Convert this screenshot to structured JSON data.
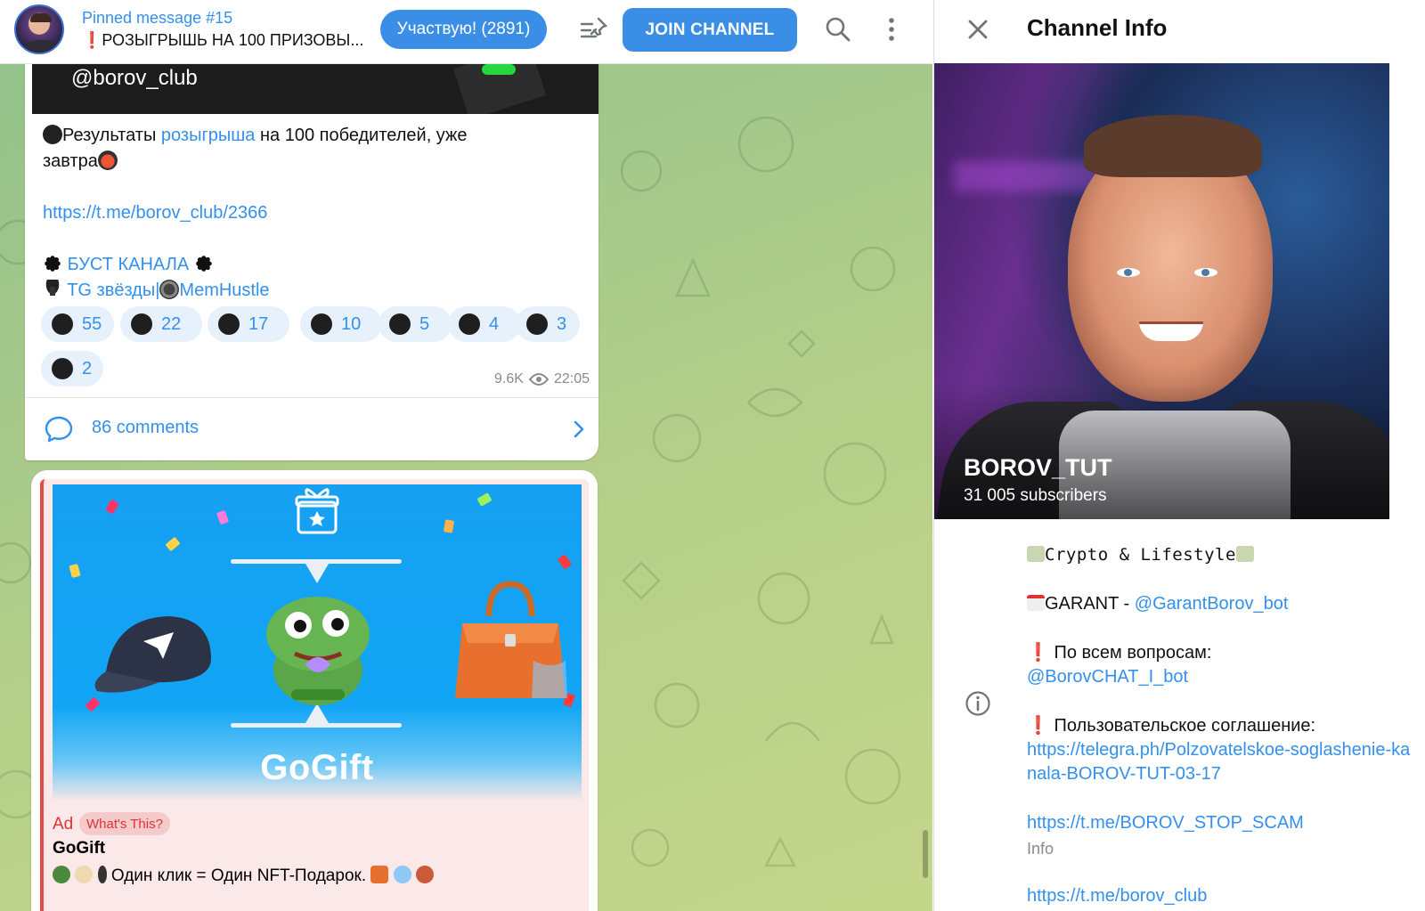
{
  "pinned": {
    "title": "Pinned message #15",
    "preview": "РОЗЫГРЫШЬ НА 100 ПРИЗОВЫ...",
    "participate_label": "Участвую! (2891)",
    "join_label": "JOIN CHANNEL"
  },
  "message1": {
    "handle": "@borov_club",
    "results_pre": "Результаты ",
    "results_link": "розыгрыша",
    "results_post": " на 100 победителей, уже",
    "results_line2": "завтра",
    "link": "https://t.me/borov_club/2366",
    "boost": "БУСТ КАНАЛА",
    "stars": "TG звёзды|",
    "memhustle": "MemHustle",
    "reactions": [
      {
        "count": "55",
        "icon": "thumbs-up-icon"
      },
      {
        "count": "22",
        "icon": "mask-icon"
      },
      {
        "count": "17",
        "icon": "verified-icon"
      },
      {
        "count": "10",
        "icon": "smile-icon"
      },
      {
        "count": "5",
        "icon": "fire-icon"
      },
      {
        "count": "4",
        "icon": "cat-icon"
      },
      {
        "count": "3",
        "icon": "moon-icon"
      },
      {
        "count": "2",
        "icon": "unicorn-icon"
      }
    ],
    "views": "9.6K",
    "time": "22:05",
    "comments_label": "86 comments"
  },
  "ad": {
    "brand": "GoGift",
    "label": "Ad",
    "whats_this": "What's This?",
    "title": "GoGift",
    "text": "Один клик = Один NFT-Подарок."
  },
  "info": {
    "title": "Channel Info",
    "name": "BOROV_TUT",
    "subscribers": "31 005 subscribers",
    "tagline": "Crypto & Lifestyle",
    "garant_label": "GARANT - ",
    "garant_link": "@GarantBorov_bot",
    "questions_label": "По всем вопросам:",
    "questions_link": "@BorovCHAT_I_bot",
    "agreement_label": "Пользовательское соглашение:",
    "agreement_link": "https://telegra.ph/Polzovatelskoe-soglashenie-kanala-BOROV-TUT-03-17",
    "scam_link": "https://t.me/BOROV_STOP_SCAM",
    "caption": "Info",
    "partial_link": "https://t.me/borov_club"
  },
  "colors": {
    "accent": "#3390ec",
    "button": "#3a8ee6",
    "ad_background": "#fbe8e8",
    "ad_accent": "#e24a4a"
  }
}
